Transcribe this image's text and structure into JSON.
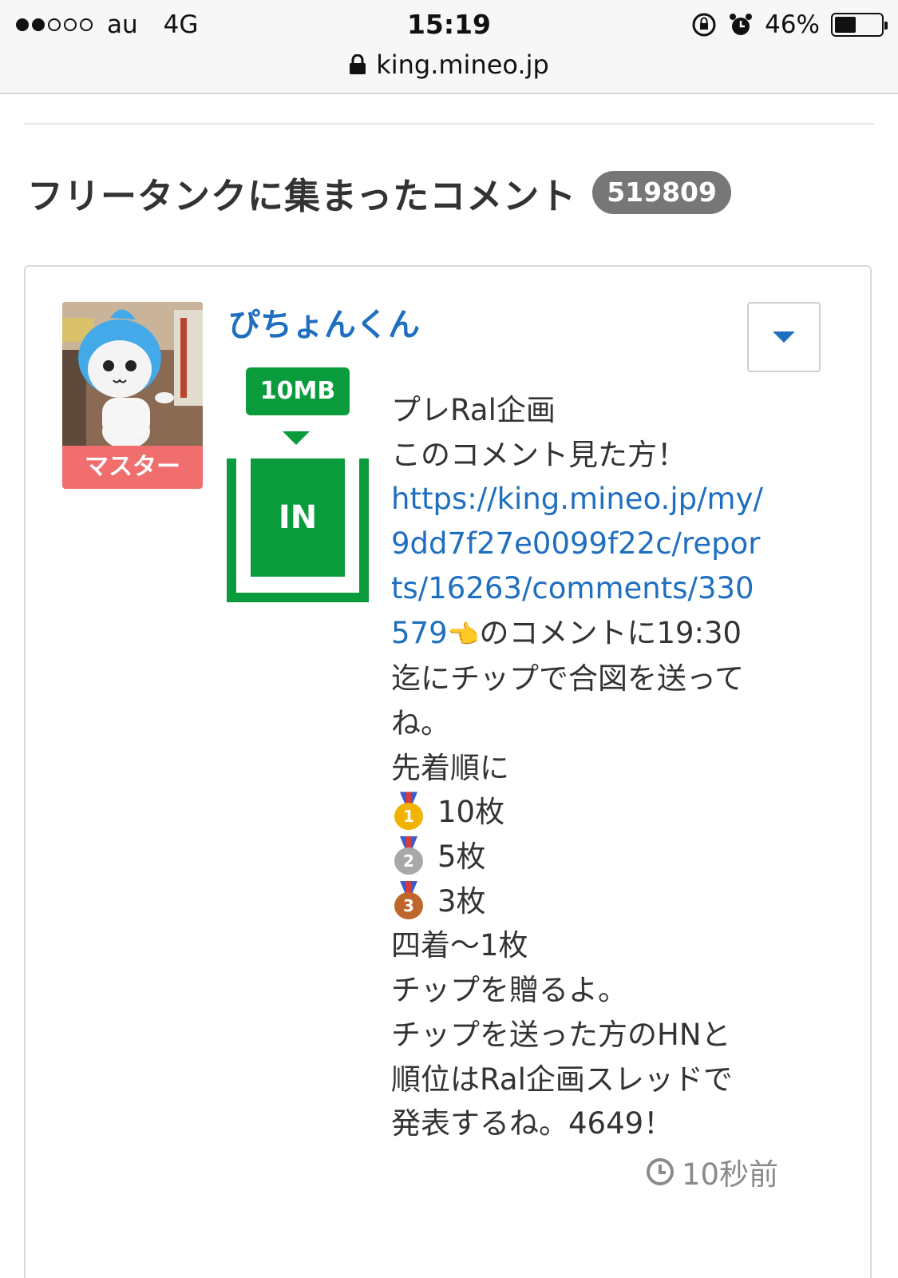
{
  "status_bar": {
    "carrier": "au",
    "network": "4G",
    "time": "15:19",
    "battery_percent": "46%",
    "battery_level": 0.46,
    "url": "king.mineo.jp"
  },
  "section": {
    "title": "フリータンクに集まったコメント",
    "count": "519809"
  },
  "comment": {
    "username": "ぴちょんくん",
    "role_badge": "マスター",
    "data_badge": "10MB",
    "tank_label": "IN",
    "lines": {
      "l1": "プレRal企画",
      "l2": "このコメント見た方！",
      "link1": "https://king.mineo.jp/my/",
      "link2": "9dd7f27e0099f22c/repor",
      "link3": "ts/16263/comments/330",
      "link4": "579",
      "pointing_emoji": "👈",
      "l4_rest": "のコメントに19:30",
      "l5": "迄にチップで合図を送って",
      "l6": "ね。",
      "l7": "先着順に",
      "gold_text": "10枚",
      "silver_text": "5枚",
      "bronze_text": "3枚",
      "l8": "四着〜1枚",
      "l9": "チップを贈るよ。",
      "l10": "チップを送った方のHNと",
      "l11": "順位はRal企画スレッドで",
      "l12": "発表するね。4649！"
    },
    "medals": {
      "gold": "1",
      "silver": "2",
      "bronze": "3"
    },
    "timestamp": "10秒前"
  },
  "colors": {
    "link": "#1f6fc0",
    "green": "#0a9b3c",
    "role_badge": "#f06e6e",
    "count_badge": "#777777"
  },
  "icons": [
    "lock-icon",
    "rotation-lock-icon",
    "alarm-icon",
    "battery-icon",
    "chevron-down-icon",
    "clock-icon",
    "medal-icon"
  ]
}
